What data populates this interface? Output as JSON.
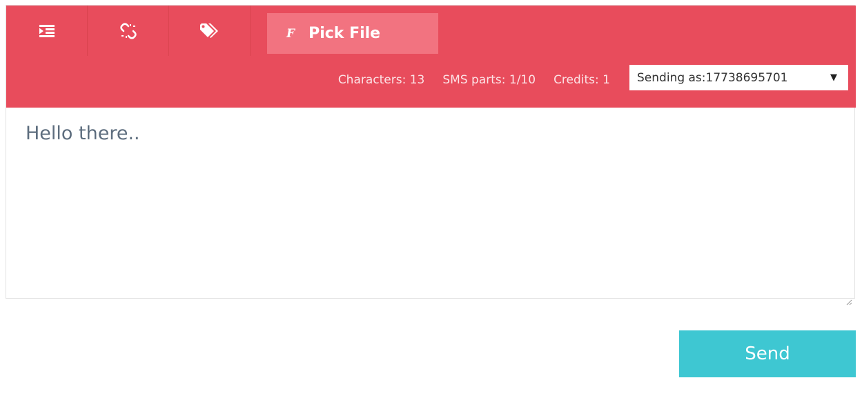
{
  "toolbar": {
    "icons": [
      "indent-icon",
      "unlink-icon",
      "tags-icon"
    ],
    "pick_file": {
      "icon": "f-icon",
      "icon_glyph": "F",
      "label": "Pick File"
    },
    "stats": {
      "characters": "Characters: 13",
      "sms_parts": "SMS parts: 1/10",
      "credits": "Credits: 1"
    },
    "sender": {
      "label": "Sending as:17738695701",
      "caret": "▼"
    }
  },
  "message": {
    "value": "Hello there.."
  },
  "send": {
    "label": "Send"
  },
  "colors": {
    "toolbar_bg": "#e84c5c",
    "pick_file_bg": "#f27380",
    "send_bg": "#3ec7d2",
    "message_text": "#5d6d7e"
  }
}
